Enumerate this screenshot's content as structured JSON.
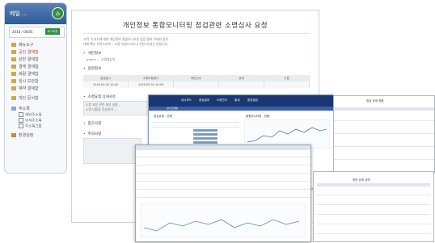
{
  "sidebar": {
    "title": "메일 ...",
    "user_text": "2018 / 06/05",
    "user_button": "로그아웃",
    "items": [
      {
        "label": "메뉴도구",
        "active": false
      },
      {
        "label": "공인 결재함",
        "active": true
      },
      {
        "label": "상반 결재함",
        "active": false
      },
      {
        "label": "결재 결재함",
        "active": false
      },
      {
        "label": "회람 결재함",
        "active": false
      },
      {
        "label": "임시 보관함",
        "active": false
      },
      {
        "label": "예약 결재함",
        "active": false
      },
      {
        "label": "개인 문서함",
        "active": false
      }
    ],
    "folder_label": "주소록",
    "subitems": [
      "개인주소록",
      "부서주소록",
      "주소록그룹"
    ],
    "settings_label": "환경설정"
  },
  "document": {
    "title": "개인정보 통합모니터링 점검관련 소명심사 요청",
    "intro_lines": [
      "고객 귀 부서에 대한 개인정보 통합모니터링 점검 결과 아래와 같이 ...",
      "대해 확인 부탁드리며 ...소명 요청드리오니 기한 내 회신 바랍니다."
    ],
    "section1": "개인정보",
    "section1_sub": "admin ... 소명대상자",
    "section2": "점검정보",
    "table_head": [
      "점검일시",
      "소명요청일시",
      "위반건수",
      "상태",
      "구분"
    ],
    "table_row": [
      "2016.03.04 10:00",
      "2016.03.04 10:00",
      "",
      "",
      ""
    ],
    "section3": "소명요청 상세사유",
    "detail_lines": [
      "소명 요청 관련 세부 내용 ...",
      "소명 내용을 작성하여 ..."
    ],
    "section4": "참고사항",
    "section5": "주의사항"
  },
  "overlay1": {
    "nav": [
      "대시보드",
      "점검결과",
      "소명관리",
      "통계",
      "환경설정"
    ],
    "tab": "실시간현황",
    "panel_title": "통합모니터링 - 현황",
    "list_label": "점검유형 - 전체"
  },
  "overlay3": {
    "title": "점검 상세 현황"
  },
  "overlay4": {
    "title": "위반 상세 내역"
  }
}
